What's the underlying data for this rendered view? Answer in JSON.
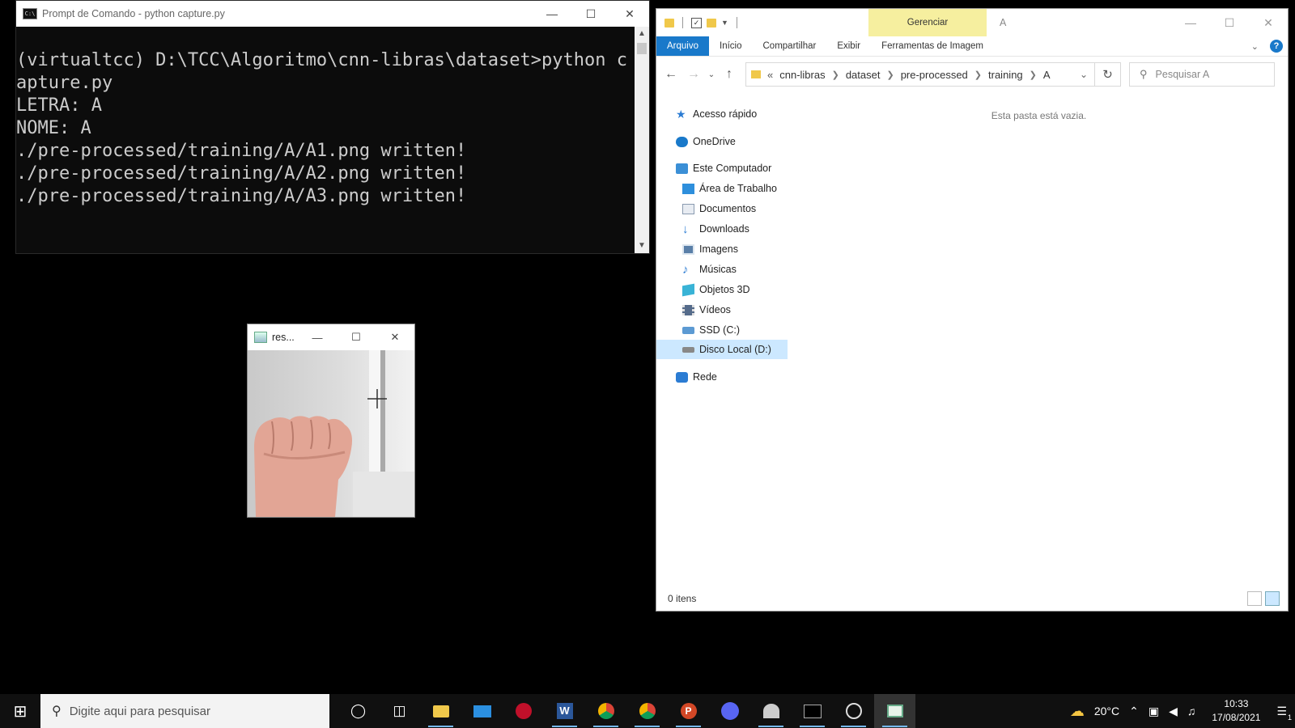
{
  "cmd": {
    "title": "Prompt de Comando - python  capture.py",
    "output": "(virtualtcc) D:\\TCC\\Algoritmo\\cnn-libras\\dataset>python capture.py\nLETRA: A\nNOME: A\n./pre-processed/training/A/A1.png written!\n./pre-processed/training/A/A2.png written!\n./pre-processed/training/A/A3.png written!"
  },
  "image_window": {
    "title": "res..."
  },
  "explorer": {
    "window_title": "A",
    "context_tab": "Gerenciar",
    "tabs": [
      "Arquivo",
      "Início",
      "Compartilhar",
      "Exibir",
      "Ferramentas de Imagem"
    ],
    "breadcrumb_prefix": "«",
    "breadcrumb": [
      "cnn-libras",
      "dataset",
      "pre-processed",
      "training",
      "A"
    ],
    "search_placeholder": "Pesquisar A",
    "nav": [
      {
        "label": "Acesso rápido",
        "icon": "star-icon",
        "color": "#2b7cd3"
      },
      {
        "label": "OneDrive",
        "icon": "cloud-icon",
        "color": "#1979ca"
      },
      {
        "label": "Este Computador",
        "icon": "computer-icon",
        "color": "#3b8fd6"
      },
      {
        "label": "Área de Trabalho",
        "icon": "desktop-icon",
        "color": "#2e8fdc"
      },
      {
        "label": "Documentos",
        "icon": "documents-icon",
        "color": "#8a9bb0"
      },
      {
        "label": "Downloads",
        "icon": "downloads-icon",
        "color": "#2b7cd3"
      },
      {
        "label": "Imagens",
        "icon": "images-icon",
        "color": "#5a7fa8"
      },
      {
        "label": "Músicas",
        "icon": "music-icon",
        "color": "#2b7cd3"
      },
      {
        "label": "Objetos 3D",
        "icon": "3d-objects-icon",
        "color": "#39b3d6"
      },
      {
        "label": "Vídeos",
        "icon": "videos-icon",
        "color": "#556b8a"
      },
      {
        "label": "SSD (C:)",
        "icon": "drive-icon",
        "color": "#5c9ad3"
      },
      {
        "label": "Disco Local (D:)",
        "icon": "drive-icon",
        "color": "#888888"
      },
      {
        "label": "Rede",
        "icon": "network-icon",
        "color": "#2b7cd3"
      }
    ],
    "selected_nav": "Disco Local (D:)",
    "empty_message": "Esta pasta está vazia.",
    "status": "0 itens"
  },
  "taskbar": {
    "search_placeholder": "Digite aqui para pesquisar",
    "temperature": "20°C",
    "time": "10:33",
    "date": "17/08/2021",
    "notification_count": "1",
    "apps": [
      "cortana-icon",
      "task-view-icon",
      "file-explorer-icon",
      "mail-icon",
      "app-icon",
      "word-icon",
      "chrome-profile-icon",
      "chrome-icon",
      "powerpoint-icon",
      "discord-icon",
      "app-icon",
      "terminal-icon",
      "obs-icon",
      "image-viewer-icon"
    ]
  },
  "colors": {
    "accent": "#1979ca",
    "manage_tab": "#f6ef9f",
    "selection": "#cce8ff"
  }
}
